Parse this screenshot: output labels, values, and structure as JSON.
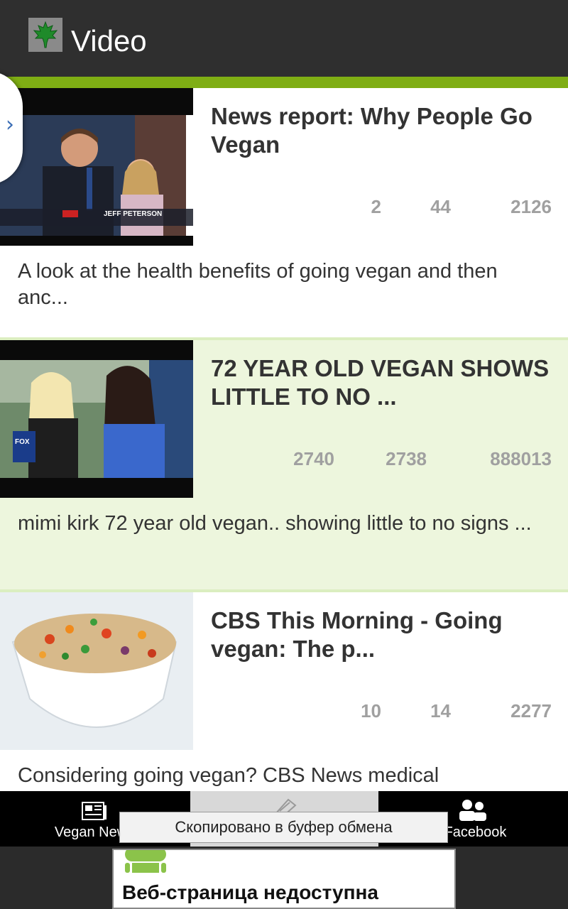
{
  "app_bar": {
    "title": "Video",
    "icon": "maple-leaf-icon"
  },
  "videos": [
    {
      "title": "News report: Why People Go Vegan",
      "stats": [
        "2",
        "44",
        "2126"
      ],
      "description": "A look at the health benefits of going vegan and then anc...",
      "thumb_caption": "JEFF PETERSON"
    },
    {
      "title": "72 YEAR OLD VEGAN SHOWS LITTLE TO NO ...",
      "stats": [
        "2740",
        "2738",
        "888013"
      ],
      "description": "mimi kirk 72 year old vegan.. showing little to no signs ...",
      "thumb_caption": "FOX"
    },
    {
      "title": "CBS This Morning - Going vegan: The p...",
      "stats": [
        "10",
        "14",
        "2277"
      ],
      "description": "Considering going vegan? CBS News medical"
    }
  ],
  "tabs": [
    {
      "label": "Vegan News",
      "icon": "newspaper-icon"
    },
    {
      "label": "",
      "icon": "film-icon"
    },
    {
      "label": "Facebook",
      "icon": "people-icon"
    }
  ],
  "toast": {
    "text": "Скопировано в буфер обмена"
  },
  "web_error": {
    "title": "Веб-страница недоступна",
    "icon": "android-icon"
  },
  "colors": {
    "accent_green": "#7fae14",
    "alt_row": "#edf6dd",
    "action_bar": "#2f2f2f"
  }
}
